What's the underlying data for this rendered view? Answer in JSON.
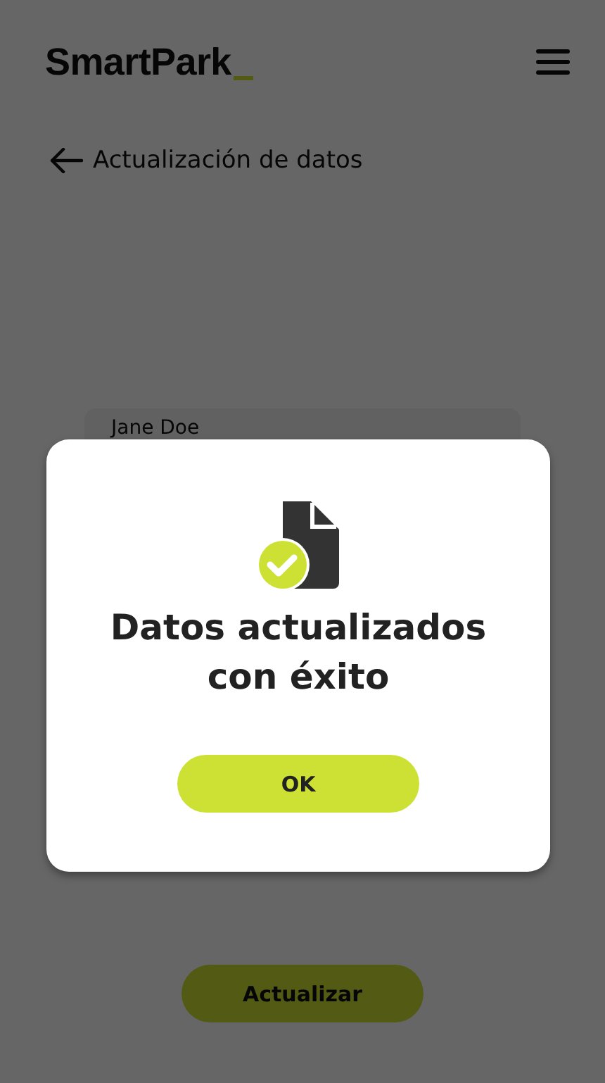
{
  "header": {
    "logo": "SmartPark"
  },
  "page": {
    "title": "Actualización de datos"
  },
  "form": {
    "name_field": {
      "value": "Jane Doe"
    },
    "submit": "Actualizar"
  },
  "dialog": {
    "open": true,
    "message": "Datos actualizados con éxito",
    "button": "OK"
  }
}
